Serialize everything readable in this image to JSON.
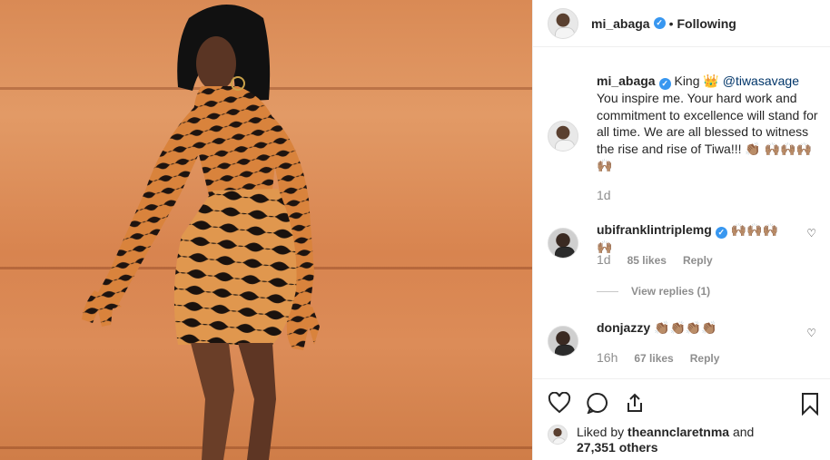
{
  "post": {
    "author": "mi_abaga",
    "follow_label": "Following",
    "separator": "•"
  },
  "caption": {
    "author": "mi_abaga",
    "pre_text": "King ",
    "crown": "👑",
    "mention": "@tiwasavage",
    "body": "You inspire me. Your hard work and commitment to excellence will stand for all time. We are all blessed to witness the rise and rise of Tiwa!!! ",
    "emoji": "👏🏽 🙌🏽🙌🏽🙌🏽🙌🏽",
    "time": "1d"
  },
  "comments": [
    {
      "user": "ubifranklintriplemg",
      "text": " 🙌🏽🙌🏽🙌🏽🙌🏽",
      "time": "1d",
      "likes": "85 likes",
      "reply": "Reply",
      "view_replies": "View replies (1)"
    },
    {
      "user": "donjazzy",
      "text": " 👏🏽👏🏽👏🏽👏🏽",
      "time": "16h",
      "likes": "67 likes",
      "reply": "Reply"
    }
  ],
  "likes": {
    "prefix": "Liked by ",
    "user": "theannclaretnma",
    "suffix": " and",
    "count": "27,351 others"
  },
  "colors": {
    "accent": "#3897f0",
    "mention": "#003569",
    "muted": "#8e8e8e"
  },
  "icons": [
    "verified-badge",
    "heart-icon",
    "comment-icon",
    "share-icon",
    "bookmark-icon"
  ]
}
